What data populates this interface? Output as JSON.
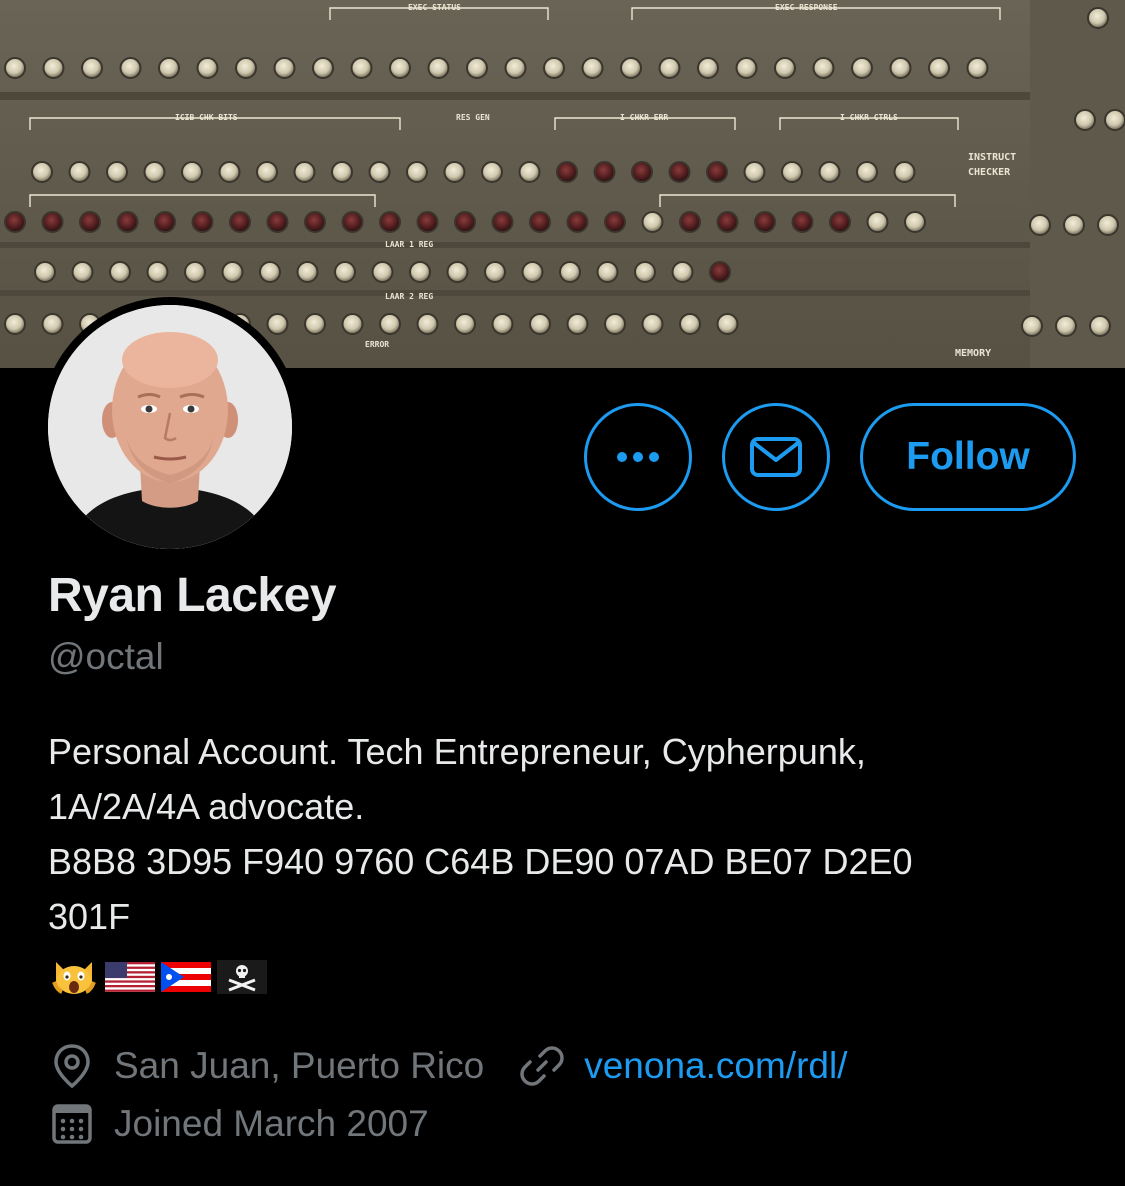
{
  "banner": {
    "panel_labels": [
      "EXEC STATUS",
      "EXEC RESPONSE",
      "ICIB CHK BITS",
      "RES GEN",
      "I CHKR ERR",
      "I CHKR CTRLS",
      "INSTRUCT",
      "CHECKER",
      "LAAR 1 REG",
      "LAAR 2 REG",
      "ERROR",
      "MEMORY"
    ]
  },
  "profile": {
    "display_name": "Ryan Lackey",
    "handle": "@octal",
    "bio_lines": [
      "Personal Account. Tech Entrepreneur, Cypherpunk,",
      "1A/2A/4A advocate.",
      "B8B8 3D95 F940 9760 C64B DE90 07AD BE07 D2E0",
      "301F"
    ],
    "emojis": [
      "screaming-cat-emoji",
      "us-flag-emoji",
      "puerto-rico-flag-emoji",
      "pirate-flag-emoji"
    ],
    "location": "San Juan, Puerto Rico",
    "website": "venona.com/rdl/",
    "joined": "Joined March 2007"
  },
  "actions": {
    "more_icon": "more-icon",
    "message_icon": "mail-icon",
    "follow_label": "Follow"
  },
  "colors": {
    "background": "#000000",
    "accent": "#1d9bf0",
    "primary_text": "#e7e9ea",
    "secondary_text": "#71767b"
  }
}
